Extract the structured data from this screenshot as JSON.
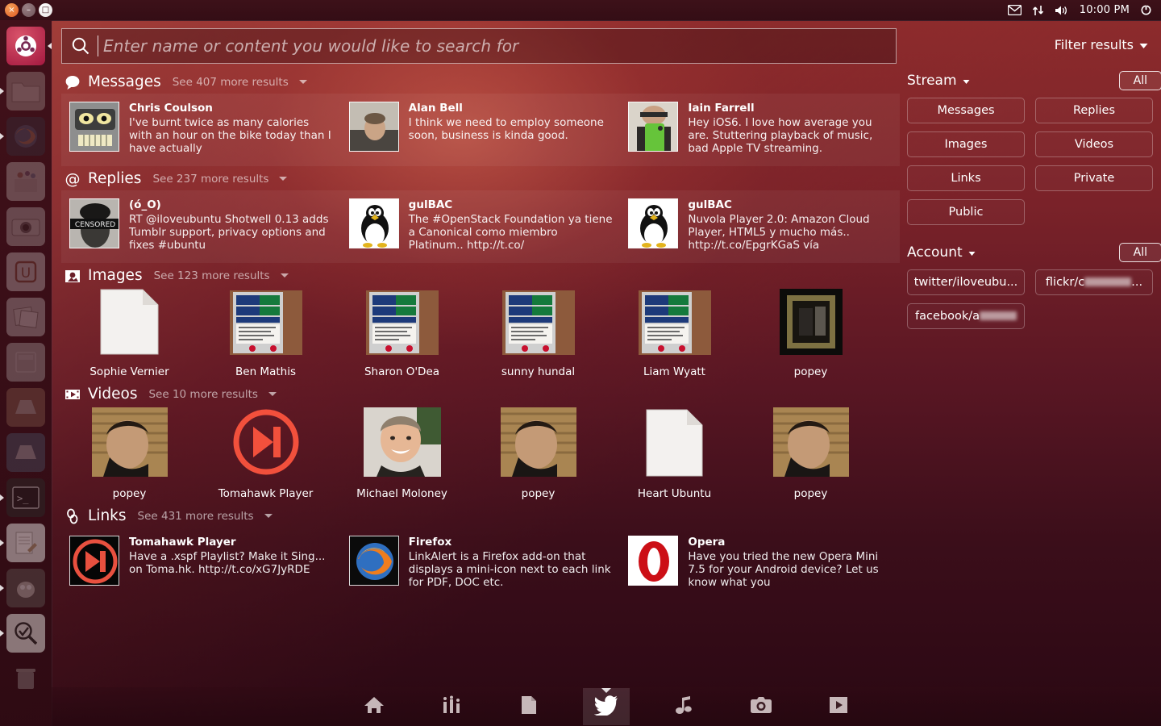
{
  "panel": {
    "window_controls": [
      {
        "name": "close",
        "glyph": "×"
      },
      {
        "name": "minimize",
        "glyph": "–"
      },
      {
        "name": "maximize",
        "glyph": "□"
      }
    ],
    "indicators": [
      "messaging-icon",
      "network-icon",
      "volume-icon",
      "power-icon"
    ],
    "clock": "10:00 PM"
  },
  "launcher": {
    "items": [
      {
        "name": "ubuntu-dash-home",
        "active": true,
        "running": false
      },
      {
        "name": "files-nautilus",
        "active": false,
        "running": true
      },
      {
        "name": "firefox",
        "active": false,
        "running": true
      },
      {
        "name": "software-center",
        "active": false,
        "running": false
      },
      {
        "name": "shotwell-camera",
        "active": false,
        "running": false
      },
      {
        "name": "ubuntu-one",
        "active": false,
        "running": false
      },
      {
        "name": "gwibber-social",
        "active": false,
        "running": false
      },
      {
        "name": "calculator",
        "active": false,
        "running": false
      },
      {
        "name": "libreoffice-impress",
        "active": false,
        "running": false
      },
      {
        "name": "libreoffice-writer",
        "active": false,
        "running": false
      },
      {
        "name": "terminal",
        "active": false,
        "running": true
      },
      {
        "name": "text-editor",
        "active": false,
        "running": true
      },
      {
        "name": "gimp",
        "active": false,
        "running": true
      },
      {
        "name": "system-settings",
        "active": false,
        "running": true
      },
      {
        "name": "trash",
        "active": false,
        "running": false
      }
    ]
  },
  "search": {
    "placeholder": "Enter name or content you would like to search for",
    "value": "",
    "icon": "search-icon"
  },
  "filter_toggle": {
    "label": "Filter results",
    "icon": "chevron-down-icon"
  },
  "categories": [
    {
      "id": "messages",
      "icon": "speech-bubble-icon",
      "title": "Messages",
      "more": "See 407 more results",
      "layout": "cards",
      "items": [
        {
          "name": "Chris Coulson",
          "snippet": "I've burnt twice as many calories with an hour on the bike today than I have actually",
          "avatar": "bender-avatar"
        },
        {
          "name": "Alan Bell",
          "snippet": "I think we need to employ someone soon, business is kinda good.",
          "avatar": "photo-man-avatar"
        },
        {
          "name": "Iain Farrell",
          "snippet": "Hey iOS6. I love how average you are. Stuttering playback of music, bad Apple TV streaming.",
          "avatar": "phone-selfie-avatar"
        }
      ]
    },
    {
      "id": "replies",
      "icon": "at-sign-icon",
      "title": "Replies",
      "more": "See 237 more results",
      "layout": "cards",
      "items": [
        {
          "name": "(ó_O)",
          "snippet": "RT @iloveubuntu Shotwell 0.13 adds Tumblr support, privacy options and fixes #ubuntu",
          "avatar": "censored-avatar"
        },
        {
          "name": "gulBAC",
          "snippet": "The #OpenStack Foundation ya tiene a Canonical como miembro Platinum.. http://t.co/",
          "avatar": "tux-avatar"
        },
        {
          "name": "gulBAC",
          "snippet": "Nuvola Player 2.0: Amazon Cloud Player, HTML5 y mucho más.. http://t.co/EpgrKGaS vía",
          "avatar": "tux-avatar"
        }
      ]
    },
    {
      "id": "images",
      "icon": "picture-frame-icon",
      "title": "Images",
      "more": "See 123 more results",
      "layout": "tiles",
      "items": [
        {
          "label": "Sophie Vernier",
          "thumb": "blank-document"
        },
        {
          "label": "Ben Mathis",
          "thumb": "tube-sign-photo"
        },
        {
          "label": "Sharon O'Dea",
          "thumb": "tube-sign-photo"
        },
        {
          "label": "sunny hundal",
          "thumb": "tube-sign-photo"
        },
        {
          "label": "Liam Wyatt",
          "thumb": "tube-sign-photo"
        },
        {
          "label": "popey",
          "thumb": "dark-frame-photo"
        }
      ]
    },
    {
      "id": "videos",
      "icon": "film-strip-icon",
      "title": "Videos",
      "more": "See 10 more results",
      "layout": "tiles",
      "items": [
        {
          "label": "popey",
          "thumb": "man-blinds-photo"
        },
        {
          "label": "Tomahawk Player",
          "thumb": "tomahawk-logo"
        },
        {
          "label": "Michael Moloney",
          "thumb": "man-smiling-photo"
        },
        {
          "label": "popey",
          "thumb": "man-blinds-photo"
        },
        {
          "label": "Heart Ubuntu",
          "thumb": "blank-document"
        },
        {
          "label": "popey",
          "thumb": "man-blinds-photo"
        }
      ]
    },
    {
      "id": "links",
      "icon": "chain-link-icon",
      "title": "Links",
      "more": "See 431 more results",
      "layout": "cards",
      "items": [
        {
          "name": "Tomahawk Player",
          "snippet": "Have a .xspf Playlist? Make it Sing... on Toma.hk. http://t.co/xG7JyRDE",
          "avatar": "tomahawk-logo"
        },
        {
          "name": "Firefox",
          "snippet": "LinkAlert is a Firefox add-on that displays a mini-icon next to each link for PDF, DOC etc.",
          "avatar": "firefox-logo"
        },
        {
          "name": "Opera",
          "snippet": "Have you tried the new Opera Mini 7.5 for your Android device? Let us know what you",
          "avatar": "opera-logo"
        }
      ]
    }
  ],
  "filters": {
    "stream": {
      "label": "Stream",
      "all_label": "All",
      "options": [
        "Messages",
        "Replies",
        "Images",
        "Videos",
        "Links",
        "Private",
        "Public"
      ]
    },
    "account": {
      "label": "Account",
      "all_label": "All",
      "options": [
        {
          "visible": "twitter/iloveubu...",
          "redacted": false
        },
        {
          "visible": "flickr/c",
          "suffix": "...",
          "redacted": true
        },
        {
          "visible": "facebook/a",
          "suffix": "",
          "redacted": true
        }
      ]
    }
  },
  "lensbar": {
    "lenses": [
      {
        "name": "home-lens",
        "icon": "home-icon",
        "active": false
      },
      {
        "name": "applications-lens",
        "icon": "apps-icon",
        "active": false
      },
      {
        "name": "files-lens",
        "icon": "document-icon",
        "active": false
      },
      {
        "name": "social-lens",
        "icon": "twitter-bird-icon",
        "active": true
      },
      {
        "name": "music-lens",
        "icon": "music-note-icon",
        "active": false
      },
      {
        "name": "photos-lens",
        "icon": "camera-icon",
        "active": false
      },
      {
        "name": "video-lens",
        "icon": "play-box-icon",
        "active": false
      }
    ]
  },
  "colors": {
    "dash_top": "#8c2b2c",
    "dash_bottom": "#2a0813",
    "panel": "#3d1119",
    "accent_orange": "#df5a22",
    "tomahawk_red": "#f24b3f"
  }
}
